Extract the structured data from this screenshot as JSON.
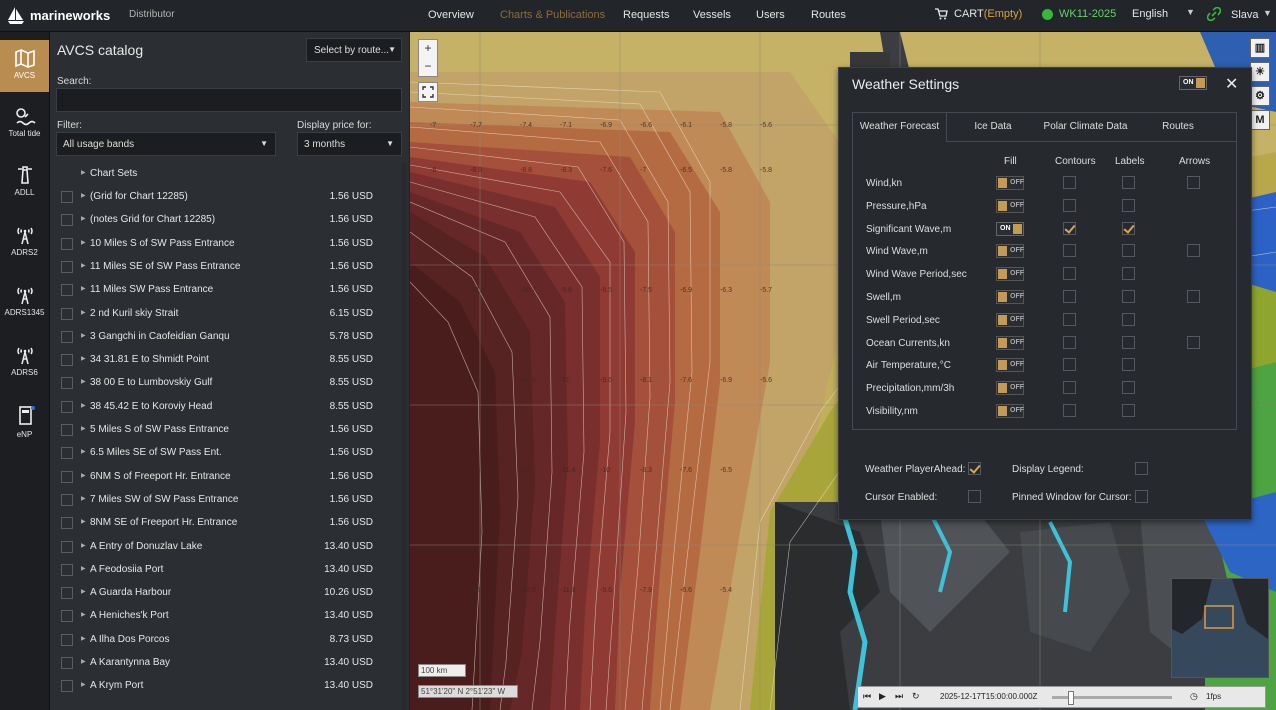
{
  "header": {
    "brand": "marineworks",
    "role": "Distributor",
    "nav": [
      "Overview",
      "Charts & Publications",
      "Requests",
      "Vessels",
      "Users",
      "Routes"
    ],
    "active_nav": "Charts & Publications",
    "cart_label": "CART",
    "cart_status": "(Empty)",
    "week": "WK11-2025",
    "language": "English",
    "user": "Slava"
  },
  "leftnav": {
    "items": [
      "AVCS",
      "Total tide",
      "ADLL",
      "ADRS2",
      "ADRS1345",
      "ADRS6",
      "eNP"
    ],
    "active": "AVCS"
  },
  "catalog": {
    "title": "AVCS catalog",
    "route_select": "Select by route...",
    "search_label": "Search:",
    "filter_label": "Filter:",
    "filter_value": "All usage bands",
    "price_label": "Display price for:",
    "price_value": "3 months",
    "group_header": "Chart Sets",
    "items": [
      {
        "name": "(Grid for Chart 12285)",
        "price": "1.56 USD"
      },
      {
        "name": "(notes Grid for Chart 12285)",
        "price": "1.56 USD"
      },
      {
        "name": "10 Miles S of SW Pass Entrance",
        "price": "1.56 USD"
      },
      {
        "name": "11 Miles SE of SW Pass Entrance",
        "price": "1.56 USD"
      },
      {
        "name": "11 Miles SW Pass Entrance",
        "price": "1.56 USD"
      },
      {
        "name": "2 nd Kuril skiy Strait",
        "price": "6.15 USD"
      },
      {
        "name": "3 Gangchi in Caofeidian Ganqu",
        "price": "5.78 USD"
      },
      {
        "name": "34 31.81 E to Shmidt Point",
        "price": "8.55 USD"
      },
      {
        "name": "38 00 E to Lumbovskiy Gulf",
        "price": "8.55 USD"
      },
      {
        "name": "38 45.42 E to Koroviy Head",
        "price": "8.55 USD"
      },
      {
        "name": "5 Miles S of SW Pass Entrance",
        "price": "1.56 USD"
      },
      {
        "name": "6.5 Miles SE of SW Pass Ent.",
        "price": "1.56 USD"
      },
      {
        "name": "6NM S of Freeport Hr. Entrance",
        "price": "1.56 USD"
      },
      {
        "name": "7 Miles SW of SW Pass Entrance",
        "price": "1.56 USD"
      },
      {
        "name": "8NM SE of Freeport Hr. Entrance",
        "price": "1.56 USD"
      },
      {
        "name": "A Entry of Donuzlav Lake",
        "price": "13.40 USD"
      },
      {
        "name": "A Feodosiia Port",
        "price": "13.40 USD"
      },
      {
        "name": "A Guarda Harbour",
        "price": "10.26 USD"
      },
      {
        "name": "A Heniches'k Port",
        "price": "13.40 USD"
      },
      {
        "name": "A Ilha Dos Porcos",
        "price": "8.73 USD"
      },
      {
        "name": "A Karantynna Bay",
        "price": "13.40 USD"
      },
      {
        "name": "A Krym Port",
        "price": "13.40 USD"
      }
    ]
  },
  "map": {
    "scale": "100 km",
    "coords": "51°31'20\" N 2°51'23\" W",
    "timestamp": "2025-12-17T15:00:00.000Z",
    "fps": "1fps"
  },
  "weather": {
    "title": "Weather Settings",
    "toggle": "ON",
    "tabs": [
      "Weather Forecast",
      "Ice Data",
      "Polar Climate Data",
      "Routes"
    ],
    "active_tab": "Weather Forecast",
    "columns": [
      "Fill",
      "Contours",
      "Labels",
      "Arrows"
    ],
    "rows": [
      {
        "label": "Wind,kn",
        "fill": "OFF",
        "contours": false,
        "labels": false,
        "arrows": true,
        "arrow_checked": false
      },
      {
        "label": "Pressure,hPa",
        "fill": "OFF",
        "contours": false,
        "labels": false,
        "arrows": false
      },
      {
        "label": "Significant Wave,m",
        "fill": "ON",
        "contours": true,
        "labels": true,
        "arrows": false
      },
      {
        "label": "Wind Wave,m",
        "fill": "OFF",
        "contours": false,
        "labels": false,
        "arrows": true,
        "arrow_checked": false
      },
      {
        "label": "Wind Wave Period,sec",
        "fill": "OFF",
        "contours": false,
        "labels": false,
        "arrows": false
      },
      {
        "label": "Swell,m",
        "fill": "OFF",
        "contours": false,
        "labels": false,
        "arrows": true,
        "arrow_checked": false
      },
      {
        "label": "Swell Period,sec",
        "fill": "OFF",
        "contours": false,
        "labels": false,
        "arrows": false
      },
      {
        "label": "Ocean Currents,kn",
        "fill": "OFF",
        "contours": false,
        "labels": false,
        "arrows": true,
        "arrow_checked": false
      },
      {
        "label": "Air Temperature,°C",
        "fill": "OFF",
        "contours": false,
        "labels": false,
        "arrows": false
      },
      {
        "label": "Precipitation,mm/3h",
        "fill": "OFF",
        "contours": false,
        "labels": false,
        "arrows": false
      },
      {
        "label": "Visibility,nm",
        "fill": "OFF",
        "contours": false,
        "labels": false,
        "arrows": false
      }
    ],
    "options": [
      {
        "label": "Weather PlayerAhead:",
        "checked": true
      },
      {
        "label": "Display Legend:",
        "checked": false
      },
      {
        "label": "Cursor Enabled:",
        "checked": false
      },
      {
        "label": "Pinned Window for Cursor:",
        "checked": false
      }
    ]
  },
  "colors": {
    "accent": "#b88d4f",
    "active_nav": "#8c6d3a",
    "online": "#37b838"
  }
}
